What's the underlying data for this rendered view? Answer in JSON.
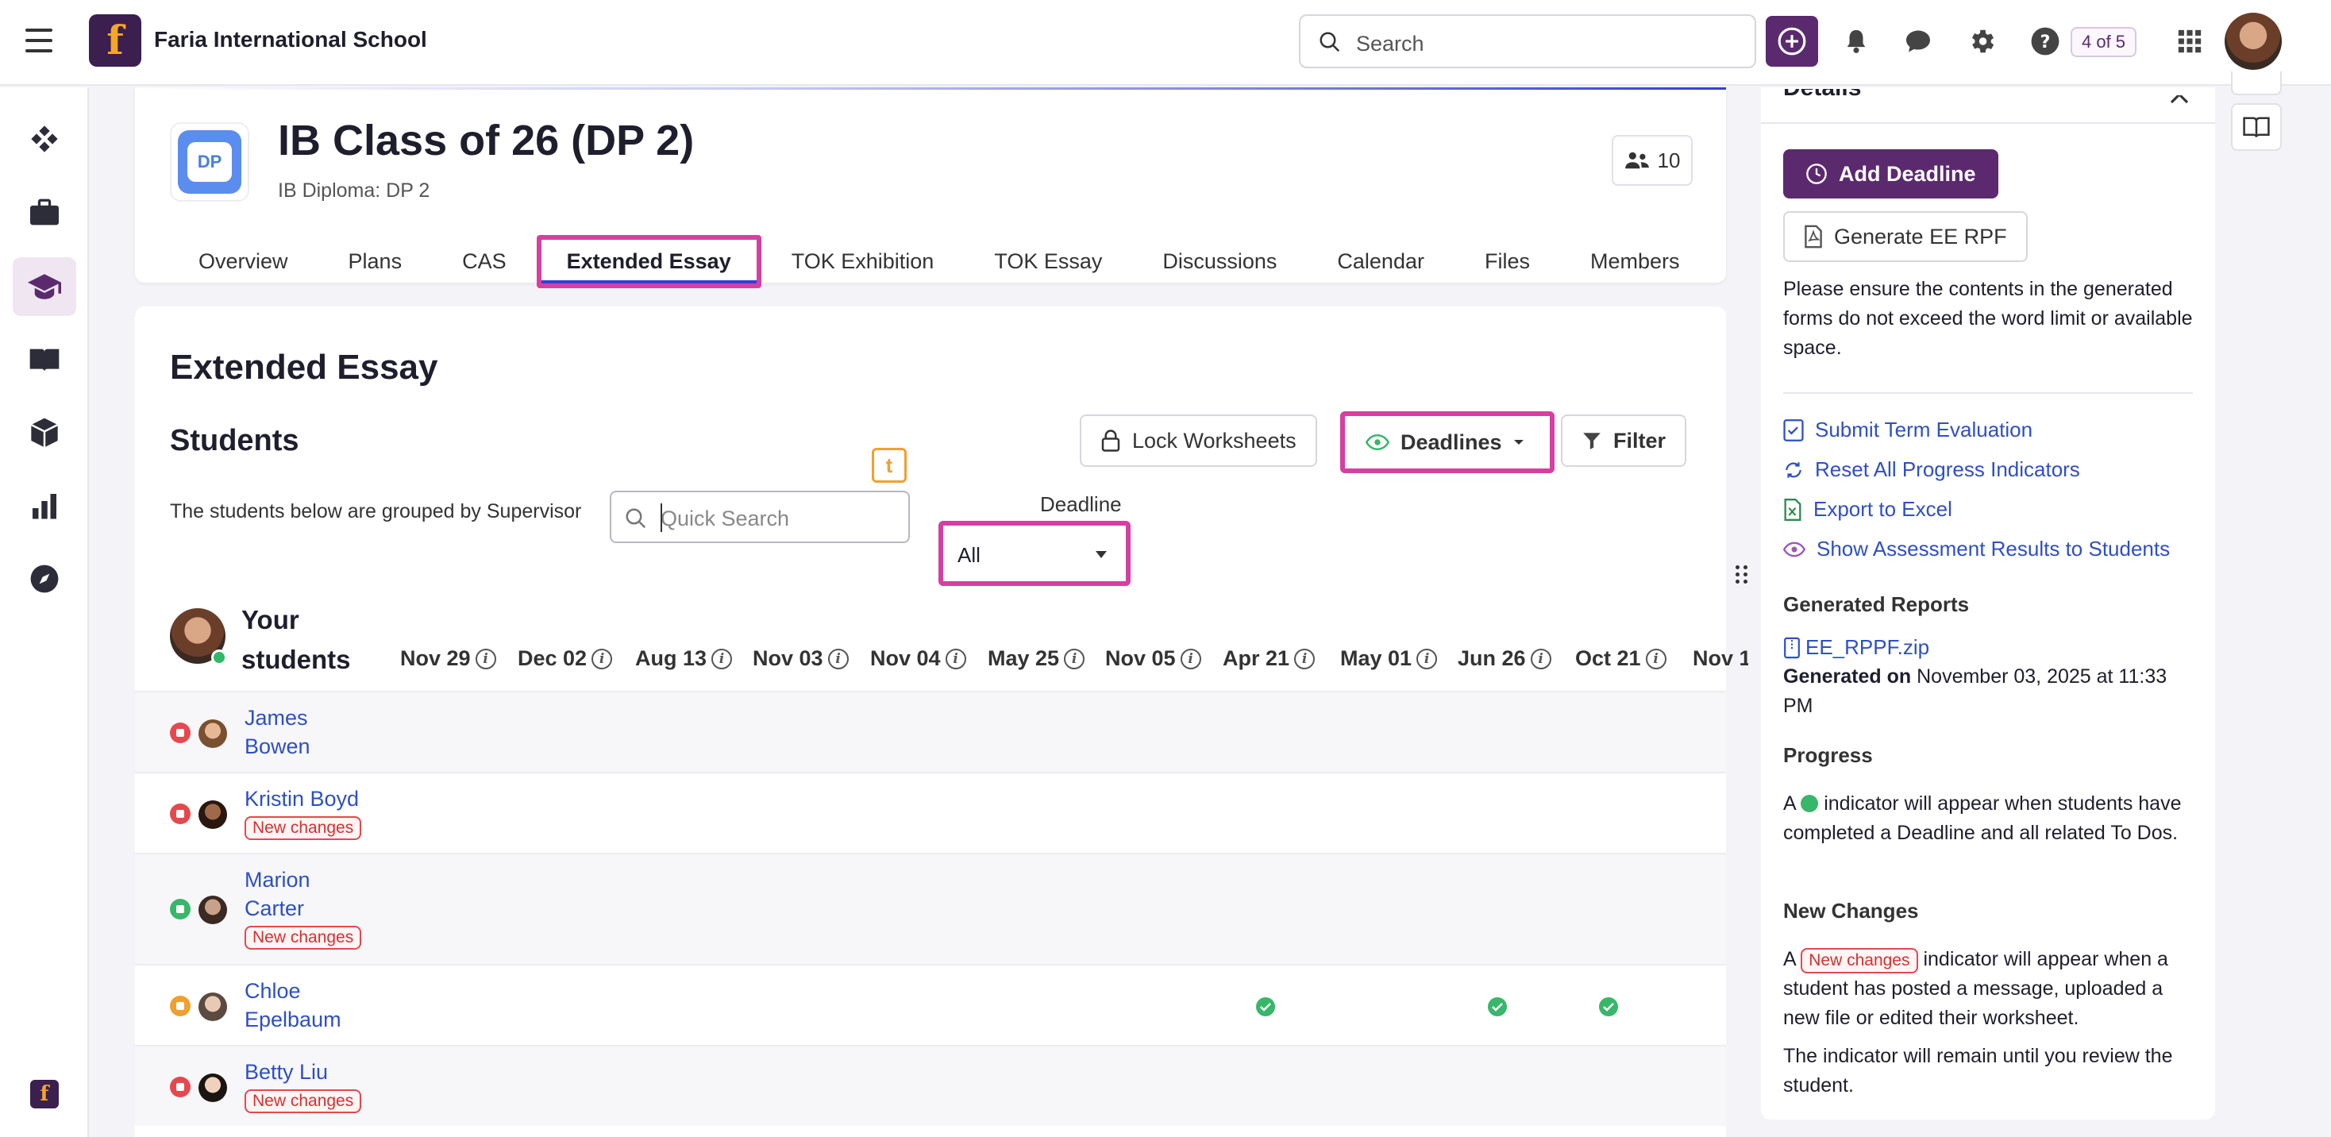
{
  "topbar": {
    "brand_name": "Faria International School",
    "brand_letter": "f",
    "search_placeholder": "Search",
    "counter": "4 of 5"
  },
  "leftrail": {
    "items": [
      "dashboard",
      "briefcase",
      "graduation-cap",
      "book",
      "cube",
      "chart",
      "compass"
    ],
    "active": "graduation-cap"
  },
  "class": {
    "tile_label": "DP",
    "title": "IB Class of 26 (DP 2)",
    "subtitle": "IB Diploma: DP 2",
    "members_count": "10",
    "tabs": [
      "Overview",
      "Plans",
      "CAS",
      "Extended Essay",
      "TOK Exhibition",
      "TOK Essay",
      "Discussions",
      "Calendar",
      "Files",
      "Members"
    ],
    "active_tab": "Extended Essay"
  },
  "content": {
    "section_title": "Extended Essay",
    "students_title": "Students",
    "lock_label": "Lock Worksheets",
    "deadlines_label": "Deadlines",
    "filter_label": "Filter",
    "group_note": "The students below are grouped by Supervisor",
    "quick_search_placeholder": "Quick Search",
    "deadline_label": "Deadline",
    "deadline_value": "All",
    "your_students": "Your students",
    "dates": [
      "Nov 29",
      "Dec 02",
      "Aug 13",
      "Nov 03",
      "Nov 04",
      "May 25",
      "Nov 05",
      "Apr 21",
      "May 01",
      "Jun 26",
      "Oct 21",
      "Nov 1"
    ],
    "new_changes_label": "New changes",
    "students": [
      {
        "first": "James",
        "last": "Bowen",
        "name_lines": [
          "James",
          "Bowen"
        ],
        "flag": "red",
        "new_changes": false,
        "checks": []
      },
      {
        "name_lines": [
          "Kristin Boyd"
        ],
        "flag": "red",
        "new_changes": true,
        "checks": []
      },
      {
        "name_lines": [
          "Marion",
          "Carter"
        ],
        "flag": "green",
        "new_changes": true,
        "checks": []
      },
      {
        "name_lines": [
          "Chloe",
          "Epelbaum"
        ],
        "flag": "amber",
        "new_changes": false,
        "checks": [
          "Apr 21",
          "Jun 26",
          "Oct 21"
        ]
      },
      {
        "name_lines": [
          "Betty Liu"
        ],
        "flag": "red",
        "new_changes": true,
        "checks": []
      }
    ]
  },
  "details": {
    "title": "Details",
    "add_deadline": "Add Deadline",
    "generate_rpf": "Generate EE RPF",
    "notice": "Please ensure the contents in the generated forms do not exceed the word limit or available space.",
    "links": [
      "Submit Term Evaluation",
      "Reset All Progress Indicators",
      "Export to Excel",
      "Show Assessment Results to Students"
    ],
    "generated_reports": "Generated Reports",
    "report_file": "EE_RPPF.zip",
    "generated_on_label": "Generated on",
    "generated_on_value": "November 03, 2025 at 11:33 PM",
    "progress_head": "Progress",
    "progress_text_a": "A",
    "progress_text_b": "indicator will appear when students have completed a Deadline and all related To Dos.",
    "newchanges_head": "New Changes",
    "newchanges_text_a": "A",
    "newchanges_badge": "New changes",
    "newchanges_text_b": "indicator will appear when a student has posted a message, uploaded a new file or edited their worksheet.",
    "remain_text": "The indicator will remain until you review the student."
  },
  "colors": {
    "brand": "#5b2a6e",
    "highlight": "#d63fa2",
    "link": "#2e4fc4",
    "success": "#38b76a",
    "danger": "#e5484d",
    "warning": "#f0a030"
  }
}
